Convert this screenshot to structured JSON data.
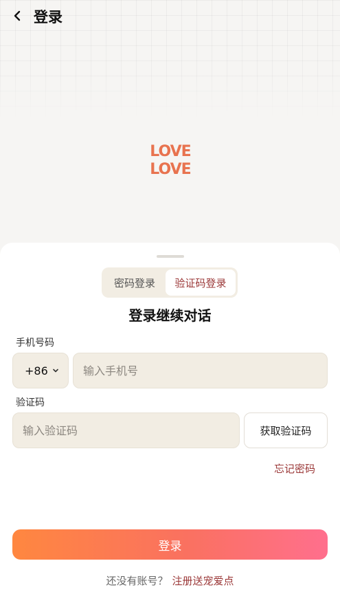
{
  "header": {
    "title": "登录",
    "back_icon": "chevron-left-icon"
  },
  "logo": {
    "line1": "LOVE",
    "line2": "LOVE",
    "color": "#e8734f"
  },
  "tabs": [
    {
      "label": "密码登录",
      "active": false
    },
    {
      "label": "验证码登录",
      "active": true
    }
  ],
  "form": {
    "heading": "登录继续对话",
    "phone_label": "手机号码",
    "country_code": "+86",
    "phone_placeholder": "输入手机号",
    "code_label": "验证码",
    "code_placeholder": "输入验证码",
    "get_code_label": "获取验证码",
    "forgot_label": "忘记密码"
  },
  "login_button": {
    "label": "登录"
  },
  "register": {
    "prompt": "还没有账号？",
    "link": "注册送宠爱点"
  },
  "colors": {
    "accent": "#9b3838",
    "button_gradient_start": "#ff8740",
    "button_gradient_end": "#ff6f8d",
    "input_bg": "#f2ede3"
  }
}
